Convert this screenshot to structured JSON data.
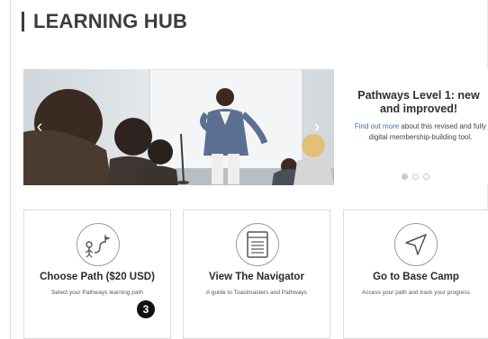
{
  "header": {
    "title": "LEARNING HUB"
  },
  "carousel": {
    "prev_glyph": "‹",
    "next_glyph": "›",
    "slide": {
      "title": "Pathways Level 1: new and improved!",
      "link_text": "Find out more",
      "body_text": " about this revised and fully digital membership-building tool."
    },
    "dots_count": 3,
    "active_dot": 0
  },
  "cards": [
    {
      "title": "Choose Path ($20 USD)",
      "description": "Select your Pathways learning path",
      "icon": "path-choice-icon",
      "badge": "3"
    },
    {
      "title": "View The Navigator",
      "description": "A guide to Toastmasters and Pathways",
      "icon": "navigator-book-icon"
    },
    {
      "title": "Go to Base Camp",
      "description": "Access your path and track your progress",
      "icon": "navigation-arrow-icon"
    }
  ],
  "colors": {
    "link": "#3a6db5",
    "title": "#3c3c3c",
    "badge": "#111111"
  }
}
